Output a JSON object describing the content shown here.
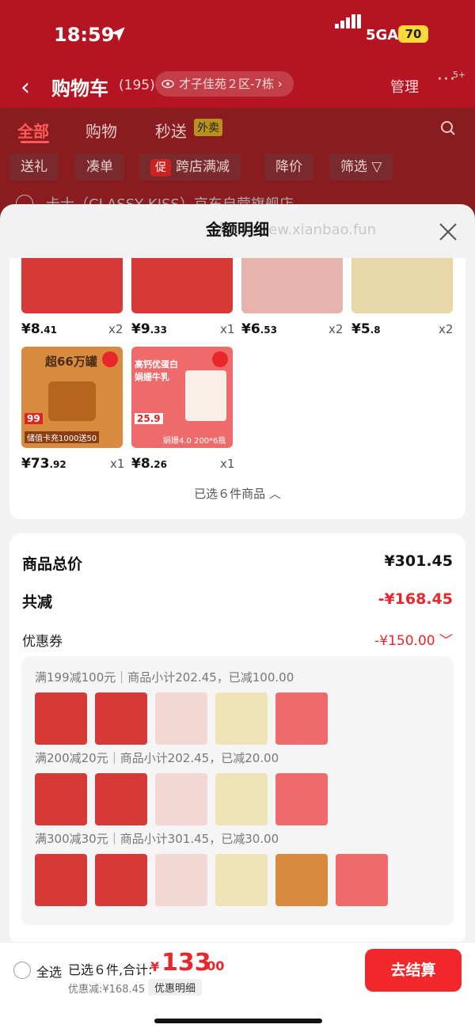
{
  "status": {
    "time": "18:59",
    "network": "5GA",
    "battery": "70"
  },
  "header": {
    "title": "购物车",
    "count": "(195)",
    "address": "才子佳苑２区-7栋",
    "manage": "管理",
    "more_badge": "5+"
  },
  "tabs": [
    {
      "label": "全部"
    },
    {
      "label": "购物"
    },
    {
      "label": "秒送"
    }
  ],
  "tab_badge": "外卖",
  "filters": [
    {
      "label": "送礼"
    },
    {
      "label": "凑单"
    },
    {
      "label": "跨店满减",
      "badge": "促"
    },
    {
      "label": "降价"
    },
    {
      "label": "筛选"
    }
  ],
  "shop_row": "卡士（CLASSY KISS）京东自营旗舰店",
  "sheet": {
    "title": "金额明细",
    "watermark": "线报酷 new.xianbao.fun",
    "items": [
      {
        "price_int": "¥8",
        "price_dec": ".41",
        "qty": "x2",
        "color": "#d63a36"
      },
      {
        "price_int": "¥9",
        "price_dec": ".33",
        "qty": "x1",
        "color": "#d63a36"
      },
      {
        "price_int": "¥6",
        "price_dec": ".53",
        "qty": "x2",
        "color": "#e9b3ad"
      },
      {
        "price_int": "¥5",
        "price_dec": ".8",
        "qty": "x2",
        "color": "#e8d8a8"
      },
      {
        "price_int": "¥73",
        "price_dec": ".92",
        "qty": "x1",
        "color": "#d88b3e"
      },
      {
        "price_int": "¥8",
        "price_dec": ".26",
        "qty": "x1",
        "color": "#ef6a6a"
      }
    ],
    "item5_text": {
      "top": "超66万罐",
      "badge": "99",
      "promo": "储值卡充1000送50"
    },
    "item6_text": {
      "headline": "高钙优蛋白 娟姗牛乳",
      "price": "25.9",
      "promo": "娟姗4.0 200*6瓶"
    },
    "selected_text": "已选６件商品"
  },
  "summary": {
    "total_label": "商品总价",
    "total_value": "¥301.45",
    "reduce_label": "共减",
    "reduce_value": "-¥168.45",
    "coupon_label": "优惠券",
    "coupon_value": "-¥150.00",
    "rules": [
      {
        "text": "满199减100元｜商品小计202.45，已减100.00",
        "thumbs": [
          "#d63a36",
          "#d63a36",
          "#f3d7d3",
          "#efe3b8",
          "#ef6a6a"
        ]
      },
      {
        "text": "满200减20元｜商品小计202.45，已减20.00",
        "thumbs": [
          "#d63a36",
          "#d63a36",
          "#f3d7d3",
          "#efe3b8",
          "#ef6a6a"
        ]
      },
      {
        "text": "满300减30元｜商品小计301.45，已减30.00",
        "thumbs": [
          "#d63a36",
          "#d63a36",
          "#f3d7d3",
          "#efe3b8",
          "#d88b3e",
          "#ef6a6a"
        ]
      }
    ]
  },
  "bottom": {
    "select_all": "全选",
    "selected_summary": "已选６件,合计:",
    "total_symbol": "¥",
    "total_int": "133",
    "total_dec": ".00",
    "discount_line": "优惠减:¥168.45",
    "detail_button": "优惠明细",
    "checkout": "去结算"
  },
  "colors": {
    "accent": "#e8262b",
    "header_bg": "#b51522"
  }
}
